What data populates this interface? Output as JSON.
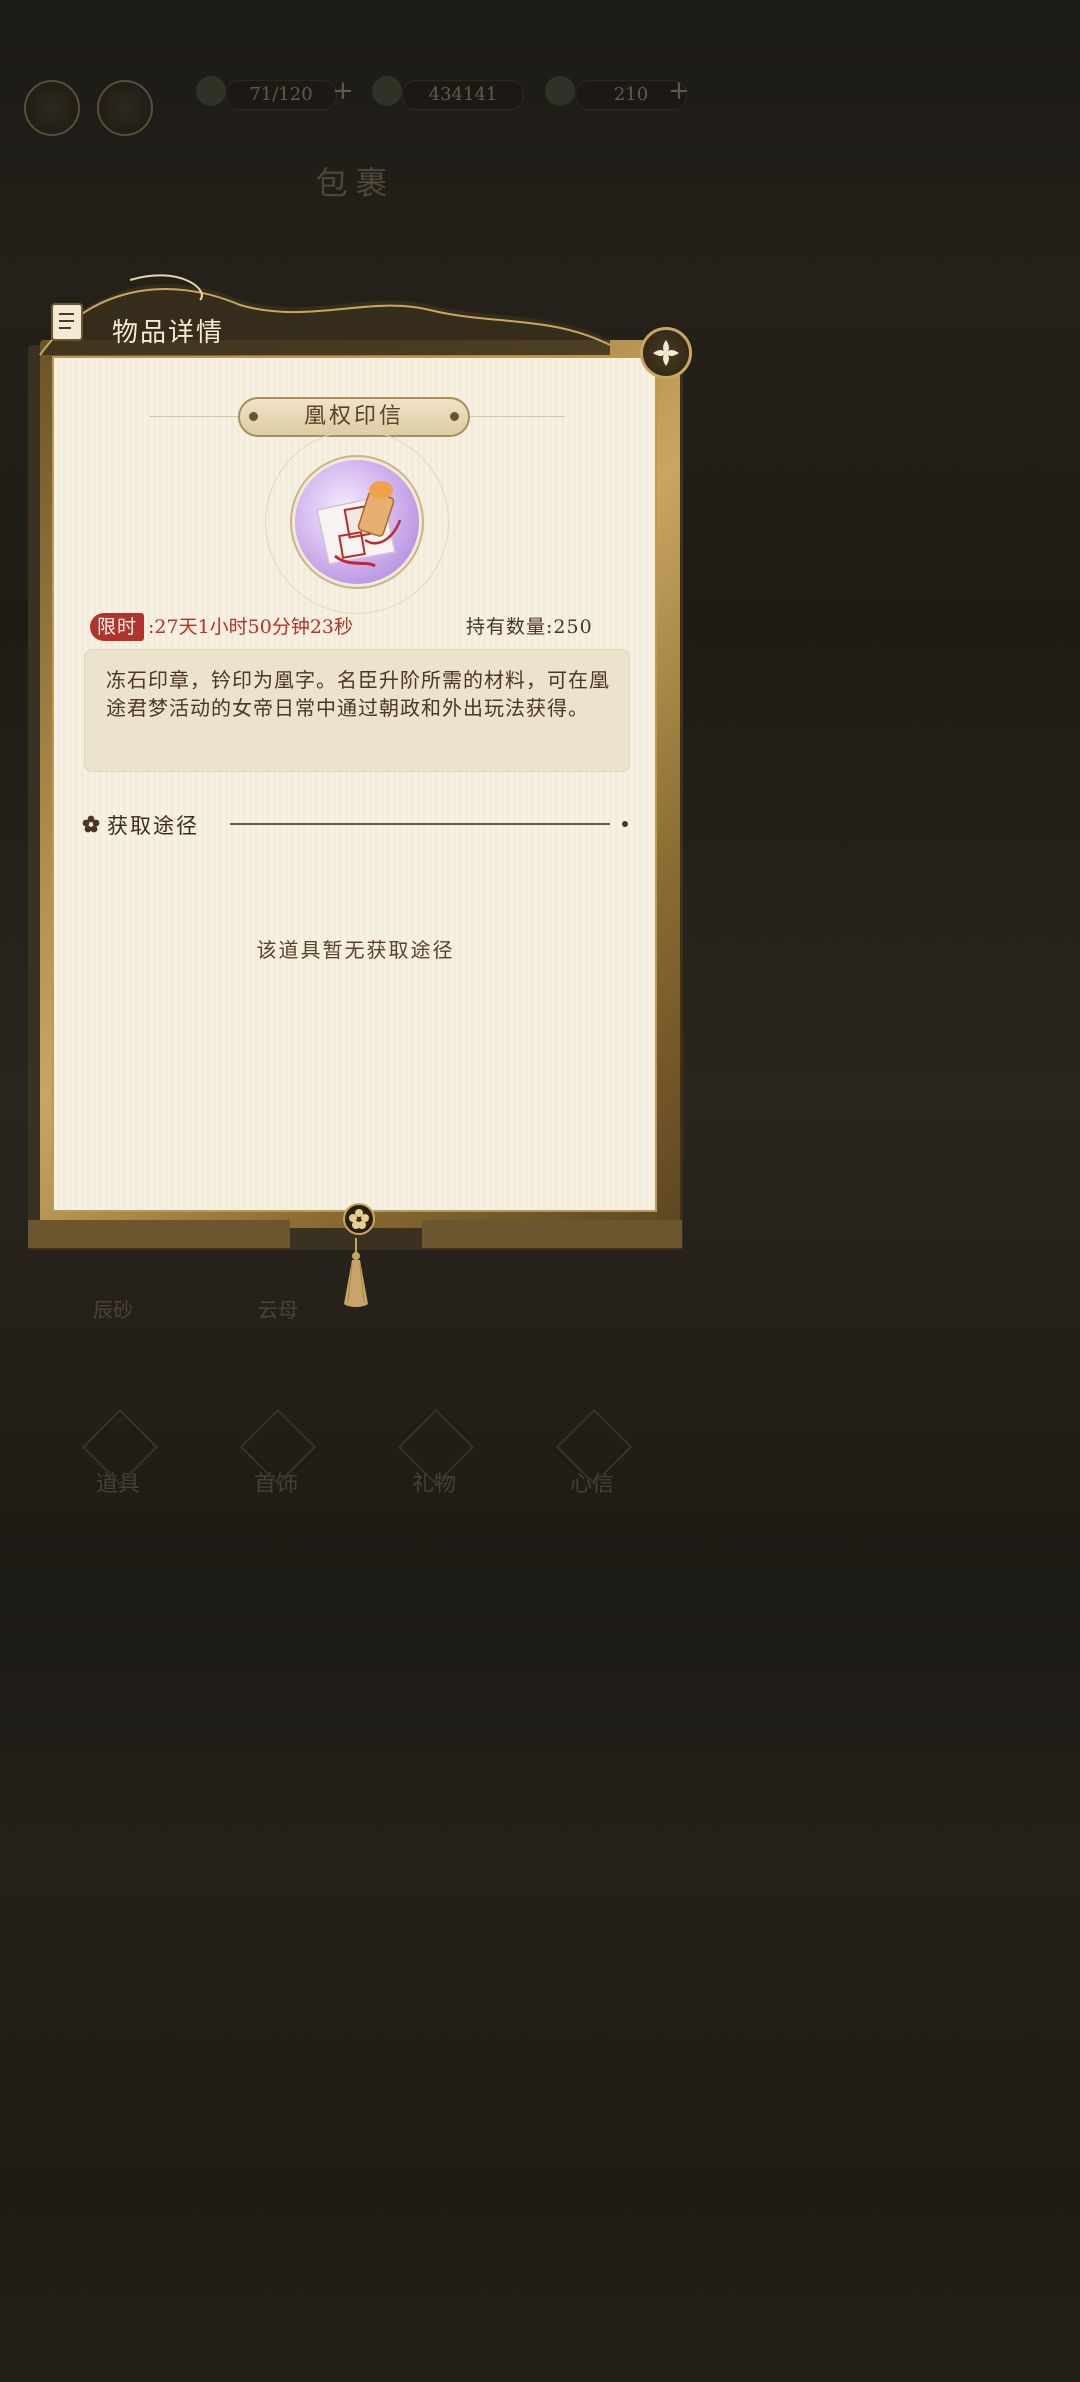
{
  "topbar": {
    "res1": "71/120",
    "res2": "434141",
    "res3": "210",
    "plus": "+"
  },
  "bag_title": "包裹",
  "panel": {
    "header_title": "物品详情",
    "item_name": "凰权印信",
    "limit_label": "限时",
    "limit_time": ":27天1小时50分钟23秒",
    "hold_count": "持有数量:250",
    "description": "冻石印章，钤印为凰字。名臣升阶所需的材料，可在凰途君梦活动的女帝日常中通过朝政和外出玩法获得。",
    "section_title": "获取途径",
    "empty_text": "该道具暂无获取途径"
  },
  "background_items": {
    "label1": "辰砂",
    "label2": "云母"
  },
  "bottom_tabs": [
    "道具",
    "首饰",
    "礼物",
    "心信"
  ],
  "colors": {
    "limit_red": "#b8302c",
    "gold": "#c9a660",
    "parchment": "#f6f1e2"
  }
}
